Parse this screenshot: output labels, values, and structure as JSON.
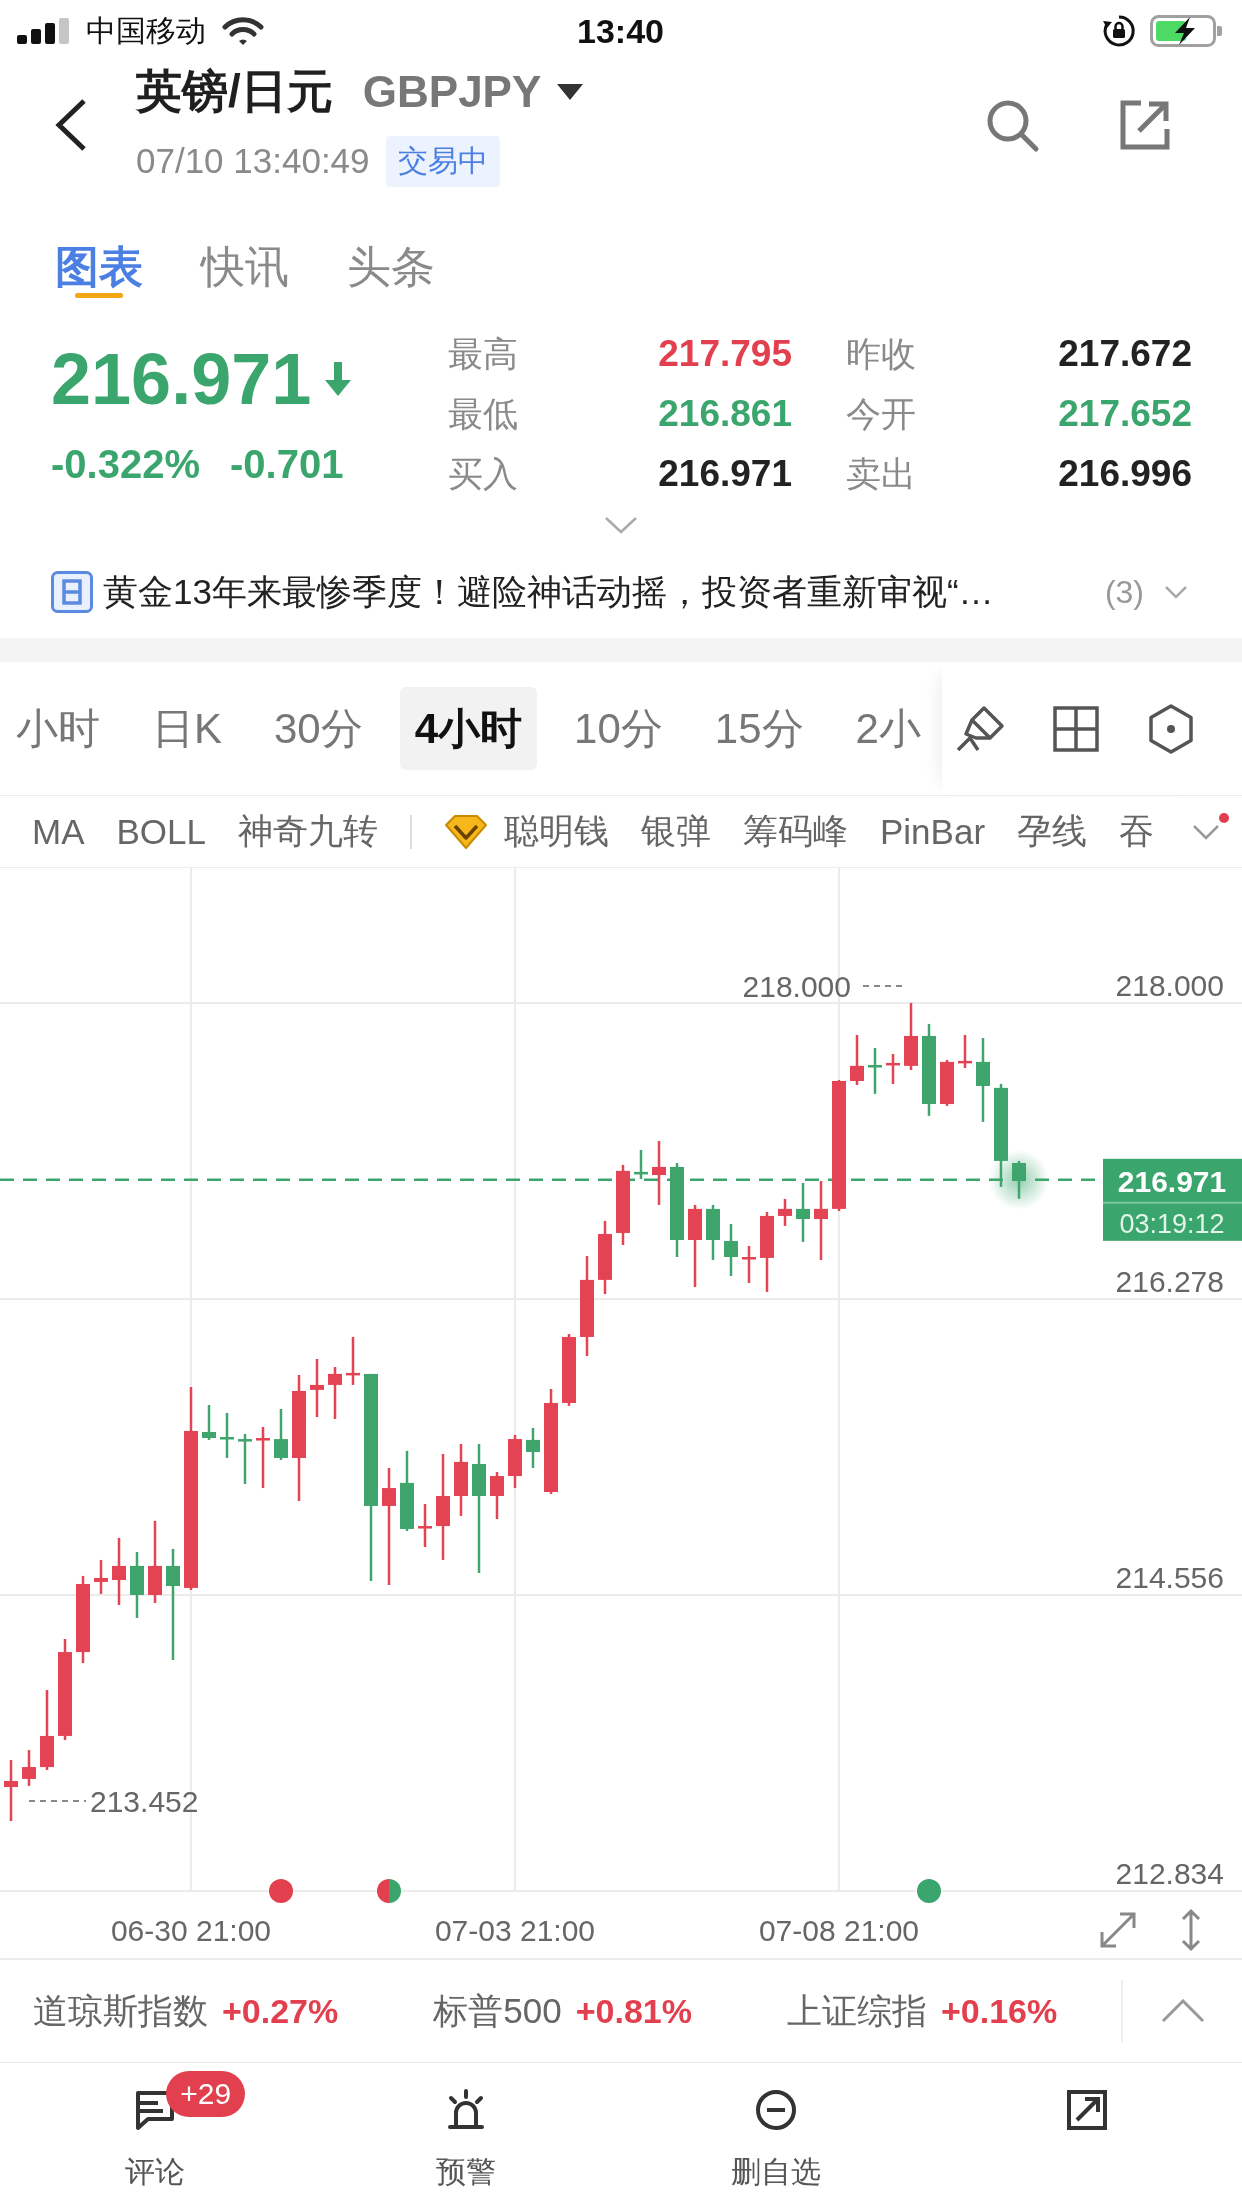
{
  "status_bar": {
    "carrier": "中国移动",
    "time": "13:40"
  },
  "header": {
    "title": "英镑/日元",
    "symbol": "GBPJPY",
    "timestamp": "07/10 13:40:49",
    "status": "交易中"
  },
  "tabs": [
    {
      "label": "图表",
      "selected": true
    },
    {
      "label": "快讯",
      "selected": false
    },
    {
      "label": "头条",
      "selected": false
    }
  ],
  "quote": {
    "price": "216.971",
    "falling": true,
    "change_percent": "-0.322%",
    "change": "-0.701",
    "stats": [
      {
        "label": "最高",
        "value": "217.795",
        "color": "#e2404f"
      },
      {
        "label": "昨收",
        "value": "217.672",
        "color": "#222222"
      },
      {
        "label": "最低",
        "value": "216.861",
        "color": "#3aa56c"
      },
      {
        "label": "今开",
        "value": "217.652",
        "color": "#3aa56c"
      },
      {
        "label": "买入",
        "value": "216.971",
        "color": "#222222"
      },
      {
        "label": "卖出",
        "value": "216.996",
        "color": "#222222"
      }
    ]
  },
  "news": {
    "headline": "黄金13年来最惨季度！避险神话动摇，投资者重新审视“…",
    "count": "(3)"
  },
  "periods": [
    {
      "label": "小时",
      "selected": false
    },
    {
      "label": "日K",
      "selected": false
    },
    {
      "label": "30分",
      "selected": false
    },
    {
      "label": "4小时",
      "selected": true
    },
    {
      "label": "10分",
      "selected": false
    },
    {
      "label": "15分",
      "selected": false
    },
    {
      "label": "2小",
      "selected": false
    }
  ],
  "indicators": {
    "basic": [
      {
        "label": "MA",
        "vip": false
      },
      {
        "label": "BOLL",
        "vip": false
      },
      {
        "label": "神奇九转",
        "vip": false
      }
    ],
    "advanced": [
      {
        "label": "聪明钱",
        "vip": true
      },
      {
        "label": "银弹",
        "vip": false
      },
      {
        "label": "筹码峰",
        "vip": false
      },
      {
        "label": "PinBar",
        "vip": false
      },
      {
        "label": "孕线",
        "vip": false
      },
      {
        "label": "吞",
        "vip": false
      }
    ],
    "menu_badge": true
  },
  "chart": {
    "chart_data": {
      "type": "candlestick",
      "categories": [
        null,
        null,
        null,
        null,
        null,
        null,
        null,
        null,
        null,
        null,
        "06-30 21:00",
        null,
        null,
        null,
        null,
        null,
        null,
        null,
        null,
        null,
        null,
        null,
        null,
        null,
        null,
        null,
        null,
        null,
        "07-03 21:00",
        null,
        null,
        null,
        null,
        null,
        null,
        null,
        null,
        null,
        null,
        null,
        null,
        null,
        null,
        null,
        null,
        null,
        "07-08 21:00",
        null,
        null,
        null,
        null,
        null,
        null,
        null,
        null,
        null,
        null
      ],
      "ohlc": [
        [
          213.439,
          213.596,
          213.241,
          213.474
        ],
        [
          213.486,
          213.654,
          213.445,
          213.555
        ],
        [
          213.555,
          214.003,
          213.538,
          213.736
        ],
        [
          213.736,
          214.3,
          213.712,
          214.224
        ],
        [
          214.224,
          214.667,
          214.16,
          214.62
        ],
        [
          214.632,
          214.76,
          214.562,
          214.655
        ],
        [
          214.643,
          214.888,
          214.498,
          214.725
        ],
        [
          214.725,
          214.806,
          214.422,
          214.556
        ],
        [
          214.556,
          214.987,
          214.509,
          214.725
        ],
        [
          214.725,
          214.824,
          214.178,
          214.608
        ],
        [
          214.597,
          215.766,
          214.585,
          215.51
        ],
        [
          215.504,
          215.661,
          215.458,
          215.469
        ],
        [
          215.475,
          215.615,
          215.353,
          215.463
        ],
        [
          215.463,
          215.493,
          215.202,
          215.452
        ],
        [
          215.458,
          215.533,
          215.178,
          215.469
        ],
        [
          215.463,
          215.638,
          215.341,
          215.353
        ],
        [
          215.353,
          215.836,
          215.103,
          215.743
        ],
        [
          215.749,
          215.929,
          215.591,
          215.778
        ],
        [
          215.778,
          215.882,
          215.58,
          215.842
        ],
        [
          215.836,
          216.057,
          215.778,
          215.848
        ],
        [
          215.842,
          215.842,
          214.637,
          215.074
        ],
        [
          215.074,
          215.295,
          214.614,
          215.178
        ],
        [
          215.208,
          215.394,
          214.928,
          214.94
        ],
        [
          214.946,
          215.085,
          214.835,
          214.957
        ],
        [
          214.957,
          215.376,
          214.76,
          215.132
        ],
        [
          215.132,
          215.434,
          215.016,
          215.33
        ],
        [
          215.318,
          215.434,
          214.684,
          215.132
        ],
        [
          215.132,
          215.271,
          214.998,
          215.248
        ],
        [
          215.248,
          215.487,
          215.178,
          215.463
        ],
        [
          215.458,
          215.528,
          215.295,
          215.388
        ],
        [
          215.155,
          215.754,
          215.144,
          215.673
        ],
        [
          215.673,
          216.074,
          215.656,
          216.057
        ],
        [
          216.057,
          216.528,
          215.946,
          216.389
        ],
        [
          216.389,
          216.732,
          216.307,
          216.656
        ],
        [
          216.662,
          217.058,
          216.592,
          217.023
        ],
        [
          217.017,
          217.145,
          216.976,
          217.005
        ],
        [
          216.999,
          217.197,
          216.825,
          217.046
        ],
        [
          217.046,
          217.069,
          216.522,
          216.621
        ],
        [
          216.621,
          216.825,
          216.348,
          216.802
        ],
        [
          216.802,
          216.825,
          216.505,
          216.621
        ],
        [
          216.615,
          216.714,
          216.412,
          216.522
        ],
        [
          216.511,
          216.586,
          216.371,
          216.522
        ],
        [
          216.517,
          216.784,
          216.319,
          216.761
        ],
        [
          216.761,
          216.86,
          216.703,
          216.802
        ],
        [
          216.802,
          216.953,
          216.61,
          216.743
        ],
        [
          216.743,
          216.964,
          216.505,
          216.802
        ],
        [
          216.802,
          217.552,
          216.79,
          217.546
        ],
        [
          217.546,
          217.814,
          217.523,
          217.634
        ],
        [
          217.639,
          217.738,
          217.471,
          217.628
        ],
        [
          217.639,
          217.703,
          217.529,
          217.651
        ],
        [
          217.634,
          218.0,
          217.61,
          217.808
        ],
        [
          217.808,
          217.878,
          217.343,
          217.412
        ],
        [
          217.412,
          217.668,
          217.401,
          217.657
        ],
        [
          217.651,
          217.814,
          217.622,
          217.663
        ],
        [
          217.657,
          217.796,
          217.308,
          217.517
        ],
        [
          217.506,
          217.529,
          216.93,
          217.081
        ],
        [
          217.069,
          217.081,
          216.861,
          216.971
        ]
      ],
      "ylim": [
        212.834,
        218.785
      ],
      "yticks": [
        {
          "value": 218,
          "label": "218.000"
        },
        {
          "value": 216.278,
          "label": "216.278"
        },
        {
          "value": 214.556,
          "label": "214.556"
        },
        {
          "value": 212.834,
          "label": "212.834"
        }
      ],
      "grid": true,
      "ref_lines": [
        {
          "axis": "y",
          "value": 216.971,
          "color": "#3aa56c"
        }
      ]
    },
    "high_label": "218.000",
    "low_label": "213.452",
    "price_tag": "216.971",
    "countdown": "03:19:12",
    "markers": [
      {
        "kind": "dot",
        "color": "#e2404f"
      },
      {
        "kind": "left_half",
        "color": "#e2404f"
      },
      {
        "kind": "right_half",
        "color": "#3aa56c"
      },
      {
        "kind": "dot",
        "color": "#3aa56c"
      }
    ]
  },
  "ticker": [
    {
      "name": "道琼斯指数",
      "change": "+0.27%",
      "color": "#e2404f"
    },
    {
      "name": "标普500",
      "change": "+0.81%",
      "color": "#e2404f"
    },
    {
      "name": "上证综指",
      "change": "+0.16%",
      "color": "#e2404f"
    }
  ],
  "bottom_nav": [
    {
      "kind": "comment",
      "label": "评论",
      "badge": "+29"
    },
    {
      "kind": "alert",
      "label": "预警"
    },
    {
      "kind": "remove",
      "label": "删自选"
    },
    {
      "kind": "share"
    }
  ]
}
